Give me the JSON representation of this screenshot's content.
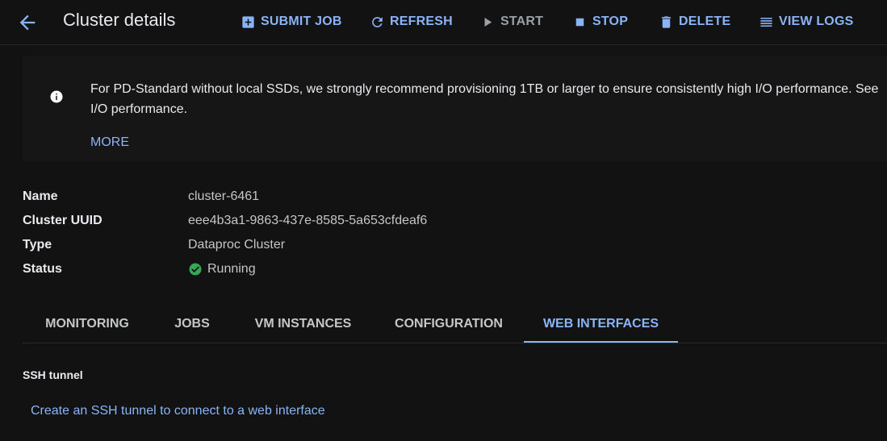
{
  "header": {
    "title": "Cluster details",
    "back_icon": "arrow-back-icon",
    "actions": [
      {
        "label": "SUBMIT JOB",
        "icon": "add-box-icon",
        "enabled": true
      },
      {
        "label": "REFRESH",
        "icon": "refresh-icon",
        "enabled": true
      },
      {
        "label": "START",
        "icon": "play-icon",
        "enabled": false
      },
      {
        "label": "STOP",
        "icon": "stop-icon",
        "enabled": true
      },
      {
        "label": "DELETE",
        "icon": "trash-icon",
        "enabled": true
      },
      {
        "label": "VIEW LOGS",
        "icon": "list-icon",
        "enabled": true
      }
    ]
  },
  "banner": {
    "icon": "info-icon",
    "text": "For PD-Standard without local SSDs, we strongly recommend provisioning 1TB or larger to ensure consistently high I/O performance. See\nI/O performance.",
    "more_label": "MORE"
  },
  "details": {
    "rows": [
      {
        "label": "Name",
        "value": "cluster-6461"
      },
      {
        "label": "Cluster UUID",
        "value": "eee4b3a1-9863-437e-8585-5a653cfdeaf6"
      },
      {
        "label": "Type",
        "value": "Dataproc Cluster"
      },
      {
        "label": "Status",
        "value": "Running",
        "icon": "check-circle-icon"
      }
    ]
  },
  "tabs": {
    "items": [
      {
        "label": "MONITORING",
        "active": false
      },
      {
        "label": "JOBS",
        "active": false
      },
      {
        "label": "VM INSTANCES",
        "active": false
      },
      {
        "label": "CONFIGURATION",
        "active": false
      },
      {
        "label": "WEB INTERFACES",
        "active": true
      }
    ]
  },
  "web_interfaces": {
    "section_title": "SSH tunnel",
    "link_label": "Create an SSH tunnel to connect to a web interface"
  },
  "colors": {
    "background": "#121212",
    "accent": "#8ab4f8",
    "text": "#e8eaed",
    "muted": "#c4c7c5",
    "disabled": "#9aa0a6",
    "success": "#34a853"
  }
}
